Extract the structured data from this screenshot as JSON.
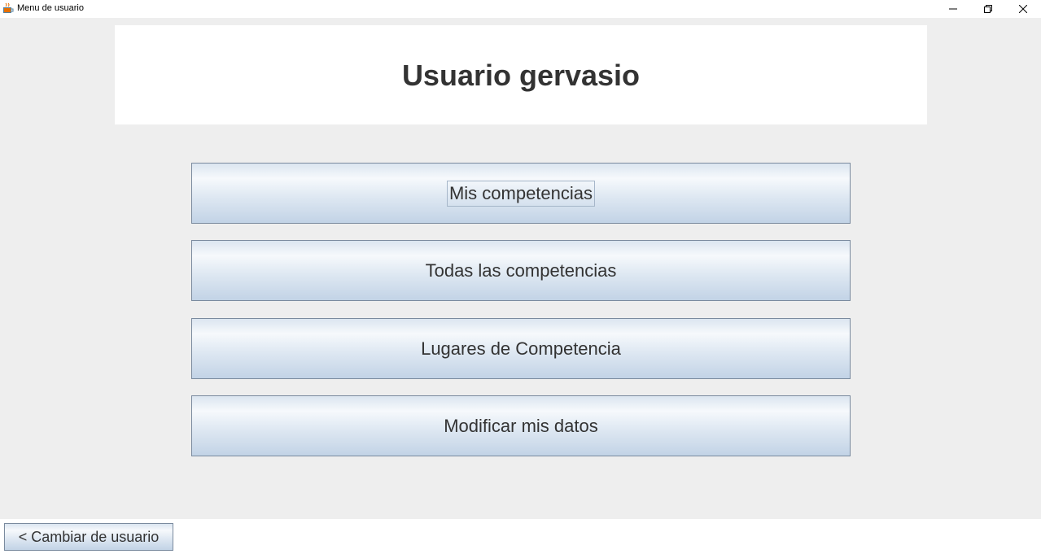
{
  "window": {
    "title": "Menu de usuario",
    "icons": {
      "app": "java-coffee-icon",
      "minimize": "minimize-icon",
      "restore": "restore-icon",
      "close": "close-icon"
    }
  },
  "header": {
    "title": "Usuario gervasio"
  },
  "menu": {
    "buttons": [
      {
        "label": "Mis competencias",
        "focused": true
      },
      {
        "label": "Todas las competencias",
        "focused": false
      },
      {
        "label": "Lugares de Competencia",
        "focused": false
      },
      {
        "label": "Modificar mis datos",
        "focused": false
      }
    ]
  },
  "footer": {
    "back_label": "< Cambiar de usuario"
  },
  "colors": {
    "background": "#eeeeee",
    "panel": "#ffffff",
    "text": "#333333",
    "button_border": "#7a8a9e"
  }
}
